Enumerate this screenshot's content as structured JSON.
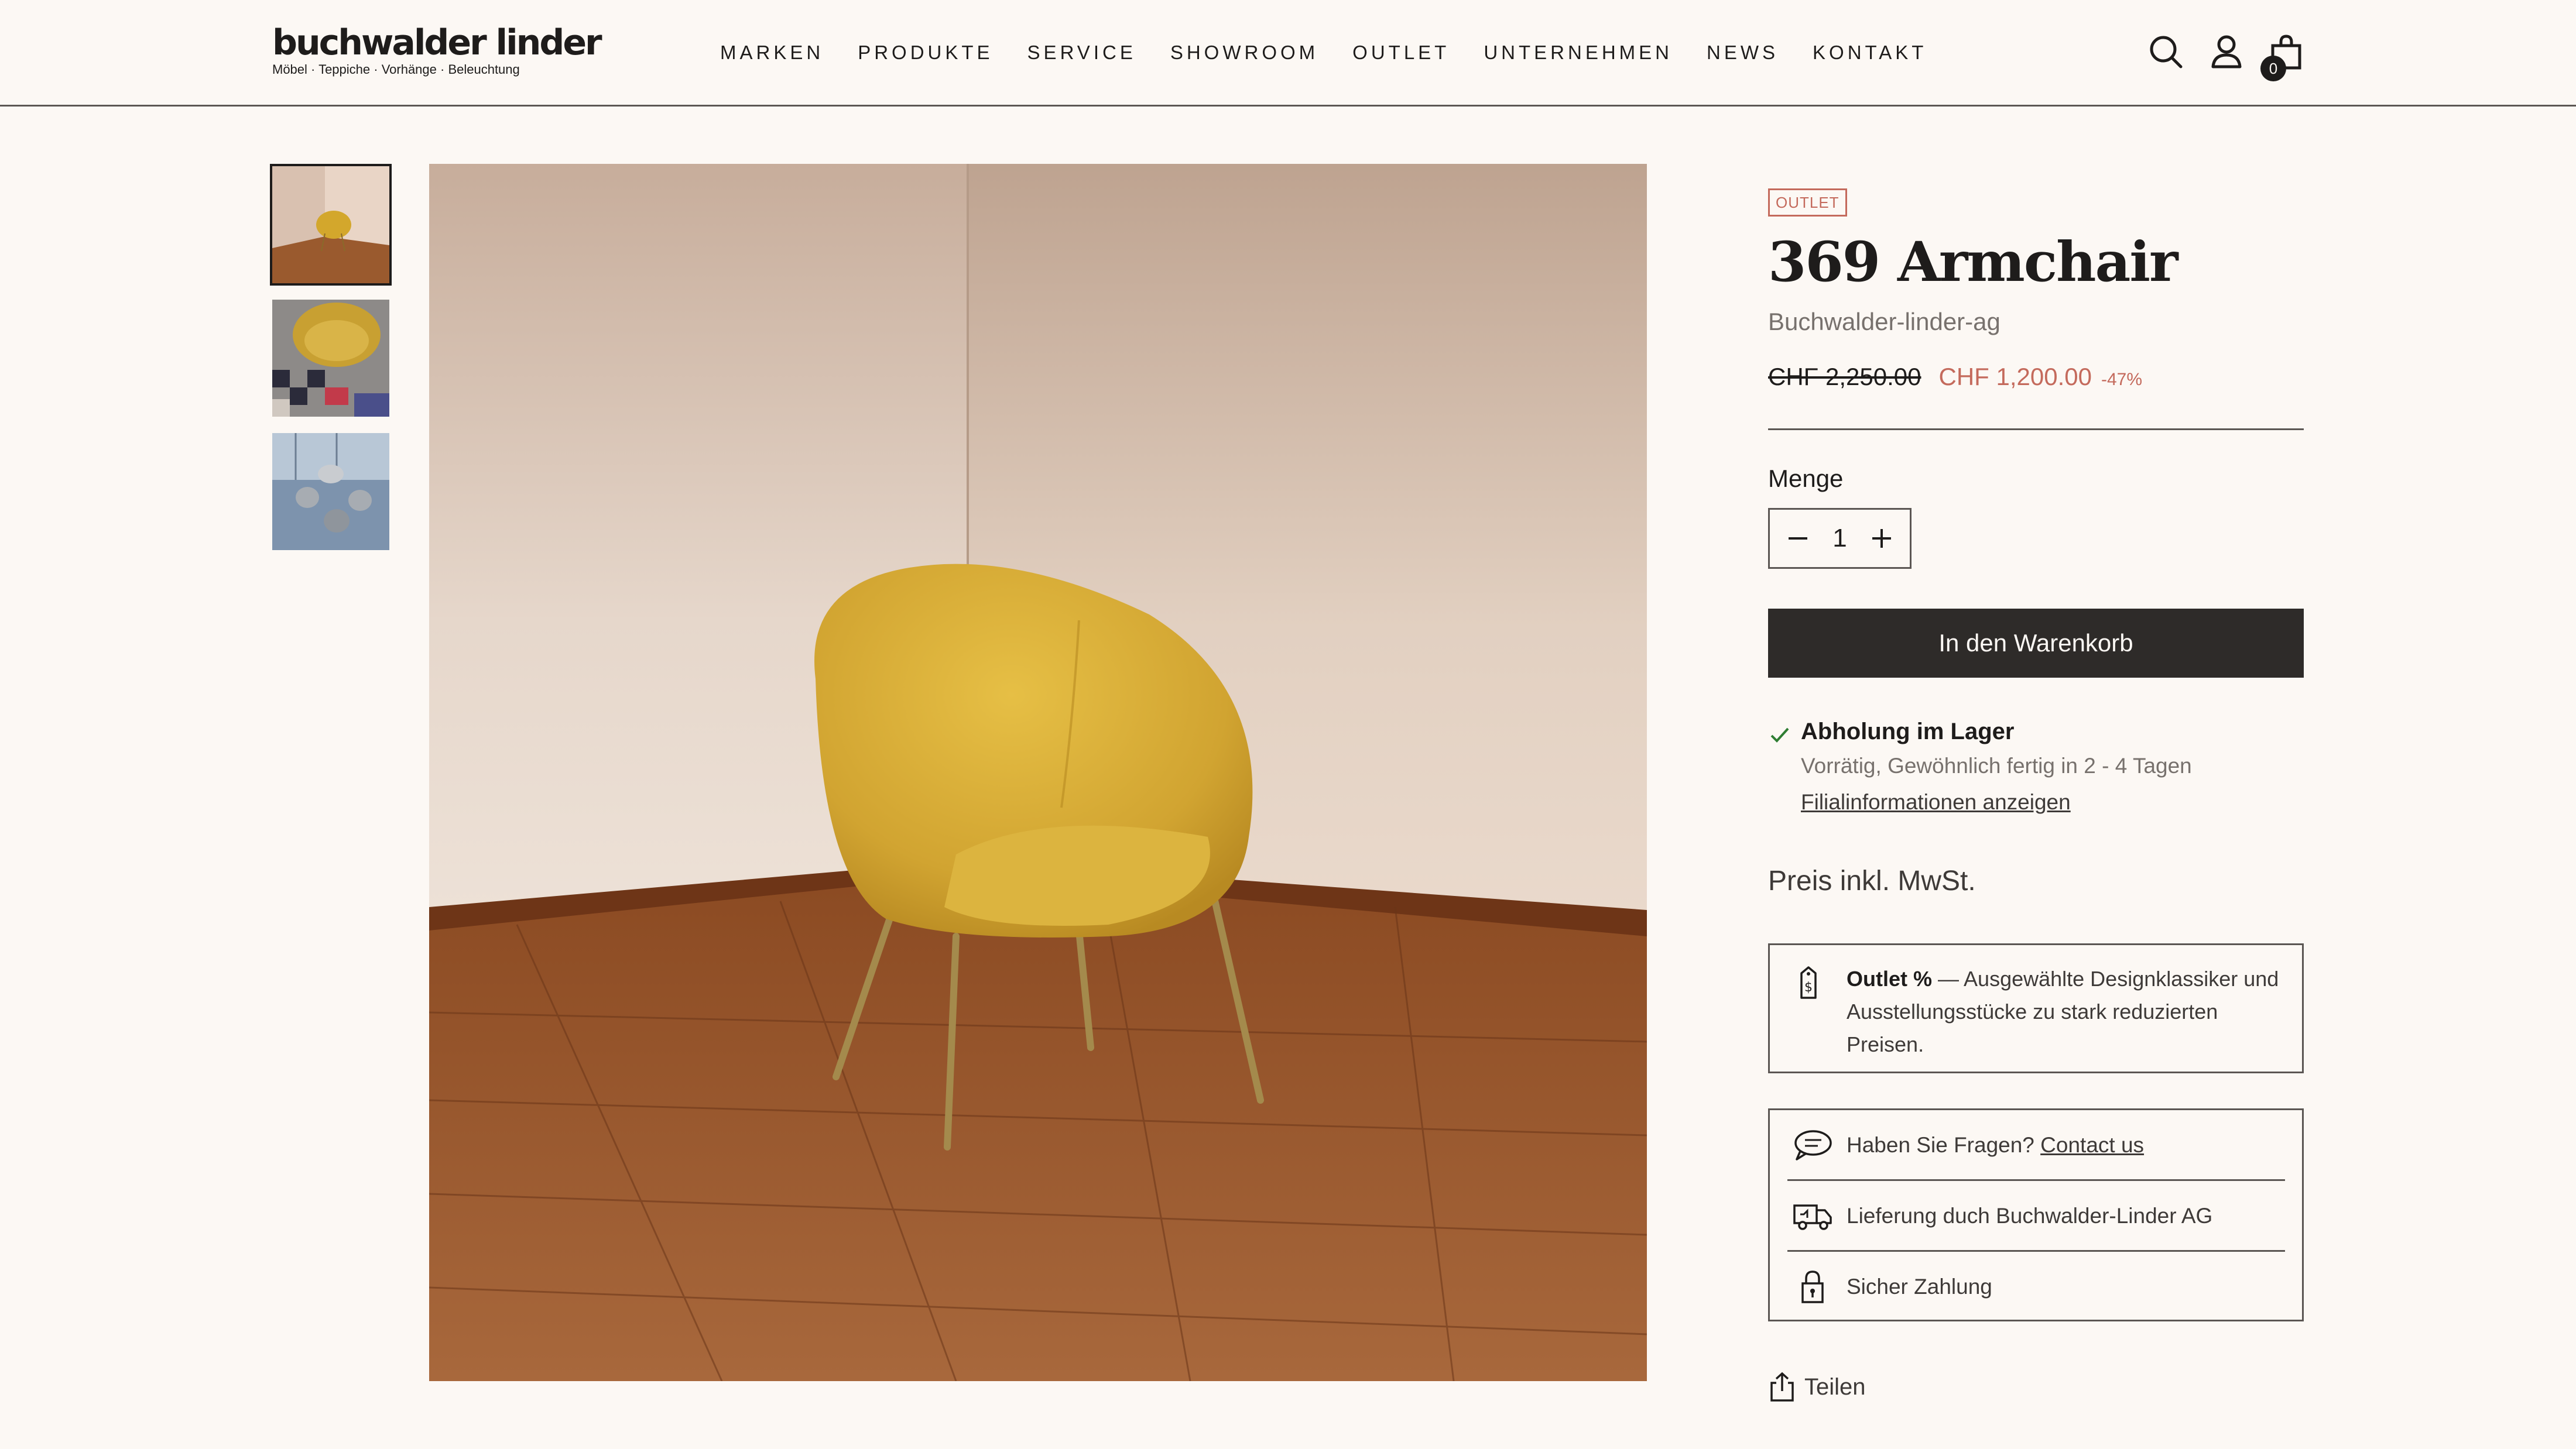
{
  "header": {
    "logo": {
      "wordmark": "buchwalder linder",
      "tagline": "Möbel · Teppiche · Vorhänge · Beleuchtung"
    },
    "nav": [
      "MARKEN",
      "PRODUKTE",
      "SERVICE",
      "SHOWROOM",
      "OUTLET",
      "UNTERNEHMEN",
      "NEWS",
      "KONTAKT"
    ],
    "icons": {
      "search": "search-icon",
      "account": "user-icon",
      "cart": "shopping-bag-icon"
    },
    "cart_count": "0"
  },
  "gallery": {
    "thumbnails": [
      "yellow chair in room",
      "yellow chair on checkered floor",
      "chairs in glass lobby"
    ],
    "selected_index": 0
  },
  "product": {
    "badge": "OUTLET",
    "title": "369 Armchair",
    "vendor": "Buchwalder-linder-ag",
    "price_old": "CHF 2,250.00",
    "price_new": "CHF 1,200.00",
    "discount": "-47%",
    "quantity_label": "Menge",
    "quantity": "1",
    "add_to_cart": "In den Warenkorb",
    "pickup_title": "Abholung im Lager",
    "pickup_sub": "Vorrätig, Gewöhnlich fertig in 2 - 4 Tagen",
    "pickup_link": "Filialinformationen anzeigen",
    "tax_note": "Preis inkl. MwSt.",
    "outlet_box": {
      "bold": "Outlet %",
      "text": " — Ausgewählte Designklassiker und Ausstellungsstücke zu stark reduzierten Preisen."
    },
    "info_rows": {
      "questions_prefix": "Haben Sie Fragen? ",
      "questions_link": "Contact us",
      "delivery": "Lieferung duch Buchwalder-Linder AG",
      "payment": "Sicher Zahlung"
    },
    "share": "Teilen"
  },
  "colors": {
    "background": "#fcf8f4",
    "text": "#1e1c1b",
    "sale": "#c46a5c",
    "button": "#2e2b29",
    "muted": "#77716d"
  }
}
